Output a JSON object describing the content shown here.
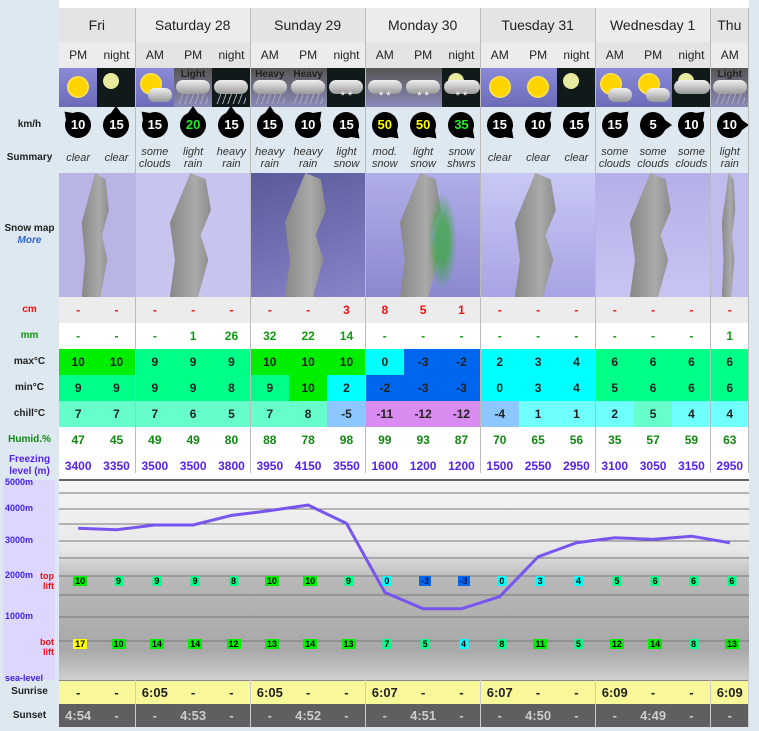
{
  "labels": {
    "wind": "km/h",
    "summary": "Summary",
    "snow_map": "Snow map",
    "more": "More",
    "snow": "cm",
    "rain": "mm",
    "max": "max°C",
    "min": "min°C",
    "chill": "chill°C",
    "humid": "Humid.%",
    "freezing": "Freezing level (m)",
    "sunrise": "Sunrise",
    "sunset": "Sunset",
    "top_lift": "top lift",
    "bot_lift": "bot lift",
    "axis": [
      "5000m",
      "4000m",
      "3000m",
      "2000m",
      "1000m",
      "sea-level"
    ]
  },
  "days": [
    {
      "name": "Fri",
      "cols": 2
    },
    {
      "name": "Saturday 28",
      "cols": 3
    },
    {
      "name": "Sunday 29",
      "cols": 3
    },
    {
      "name": "Monday 30",
      "cols": 3
    },
    {
      "name": "Tuesday 31",
      "cols": 3
    },
    {
      "name": "Wednesday 1",
      "cols": 3
    },
    {
      "name": "Thu",
      "cols": 1
    }
  ],
  "periods": [
    "PM",
    "night",
    "AM",
    "PM",
    "night",
    "AM",
    "PM",
    "night",
    "AM",
    "PM",
    "night",
    "AM",
    "PM",
    "night",
    "AM",
    "PM",
    "night",
    "AM"
  ],
  "icons": [
    "sun",
    "moon",
    "sun-cloud",
    "rain-cloud",
    "rain-night",
    "rain-cloud",
    "rain-cloud",
    "snow-night",
    "snow-cloud",
    "snow-cloud",
    "moon-cloud-snow",
    "sun",
    "sun",
    "moon",
    "sun-cloud",
    "sun-cloud",
    "moon-cloud",
    "rain-cloud"
  ],
  "icon_text": [
    "",
    "",
    "",
    "Light",
    "",
    "Heavy",
    "Heavy",
    "",
    "",
    "",
    "",
    "",
    "",
    "",
    "",
    "",
    "",
    "Light"
  ],
  "wind": [
    10,
    15,
    15,
    20,
    15,
    15,
    10,
    15,
    50,
    50,
    35,
    15,
    10,
    15,
    15,
    5,
    10,
    10
  ],
  "wind_dir": [
    -45,
    0,
    -45,
    0,
    0,
    0,
    45,
    135,
    135,
    135,
    135,
    135,
    45,
    45,
    45,
    90,
    45,
    90
  ],
  "summary": [
    "clear",
    "clear",
    "some clouds",
    "light rain",
    "heavy rain",
    "heavy rain",
    "heavy rain",
    "light snow",
    "mod. snow",
    "light snow",
    "snow shwrs",
    "clear",
    "clear",
    "clear",
    "some clouds",
    "some clouds",
    "some clouds",
    "light rain"
  ],
  "snow_cm": [
    "-",
    "-",
    "-",
    "-",
    "-",
    "-",
    "-",
    "3",
    "8",
    "5",
    "1",
    "-",
    "-",
    "-",
    "-",
    "-",
    "-",
    "-"
  ],
  "rain_mm": [
    "-",
    "-",
    "-",
    "1",
    "26",
    "32",
    "22",
    "14",
    "-",
    "-",
    "-",
    "-",
    "-",
    "-",
    "-",
    "-",
    "-",
    "1"
  ],
  "max_c": [
    10,
    10,
    9,
    9,
    9,
    10,
    10,
    10,
    0,
    -3,
    -2,
    2,
    3,
    4,
    6,
    6,
    6,
    6
  ],
  "min_c": [
    9,
    9,
    9,
    9,
    8,
    9,
    10,
    2,
    -2,
    -3,
    -3,
    0,
    3,
    4,
    5,
    6,
    6,
    6
  ],
  "chill_c": [
    7,
    7,
    7,
    6,
    5,
    7,
    8,
    -5,
    -11,
    -12,
    -12,
    -4,
    1,
    1,
    2,
    5,
    4,
    4
  ],
  "humid": [
    47,
    45,
    49,
    49,
    80,
    88,
    78,
    98,
    99,
    93,
    87,
    70,
    65,
    56,
    35,
    57,
    59,
    63
  ],
  "freezing": [
    3400,
    3350,
    3500,
    3500,
    3800,
    3950,
    4150,
    3550,
    1600,
    1200,
    1200,
    1500,
    2550,
    2950,
    3100,
    3050,
    3150,
    2950
  ],
  "top_lift": [
    10,
    9,
    9,
    9,
    8,
    10,
    10,
    9,
    0,
    -3,
    -3,
    0,
    3,
    4,
    5,
    6,
    6,
    6
  ],
  "bot_lift": [
    17,
    10,
    14,
    14,
    12,
    13,
    14,
    13,
    7,
    5,
    4,
    8,
    11,
    5,
    12,
    14,
    8,
    13
  ],
  "sunrise": [
    "-",
    "-",
    "6:05",
    "-",
    "-",
    "6:05",
    "-",
    "-",
    "6:07",
    "-",
    "-",
    "6:07",
    "-",
    "-",
    "6:09",
    "-",
    "-",
    "6:09"
  ],
  "sunset": [
    "4:54",
    "-",
    "-",
    "4:53",
    "-",
    "-",
    "4:52",
    "-",
    "-",
    "4:51",
    "-",
    "-",
    "4:50",
    "-",
    "-",
    "4:49",
    "-",
    "-"
  ],
  "colors": {
    "snow": "#ee1111",
    "rain": "#119911",
    "humid": "#118811",
    "freezing": "#5522ee",
    "line": "#7755ee",
    "sunrise_bg": "#f8f89a",
    "sunset_bg": "#5f5f5f",
    "more": "#3366cc",
    "wind_high": "#ffff00",
    "wind_mid": "#22ee22"
  }
}
